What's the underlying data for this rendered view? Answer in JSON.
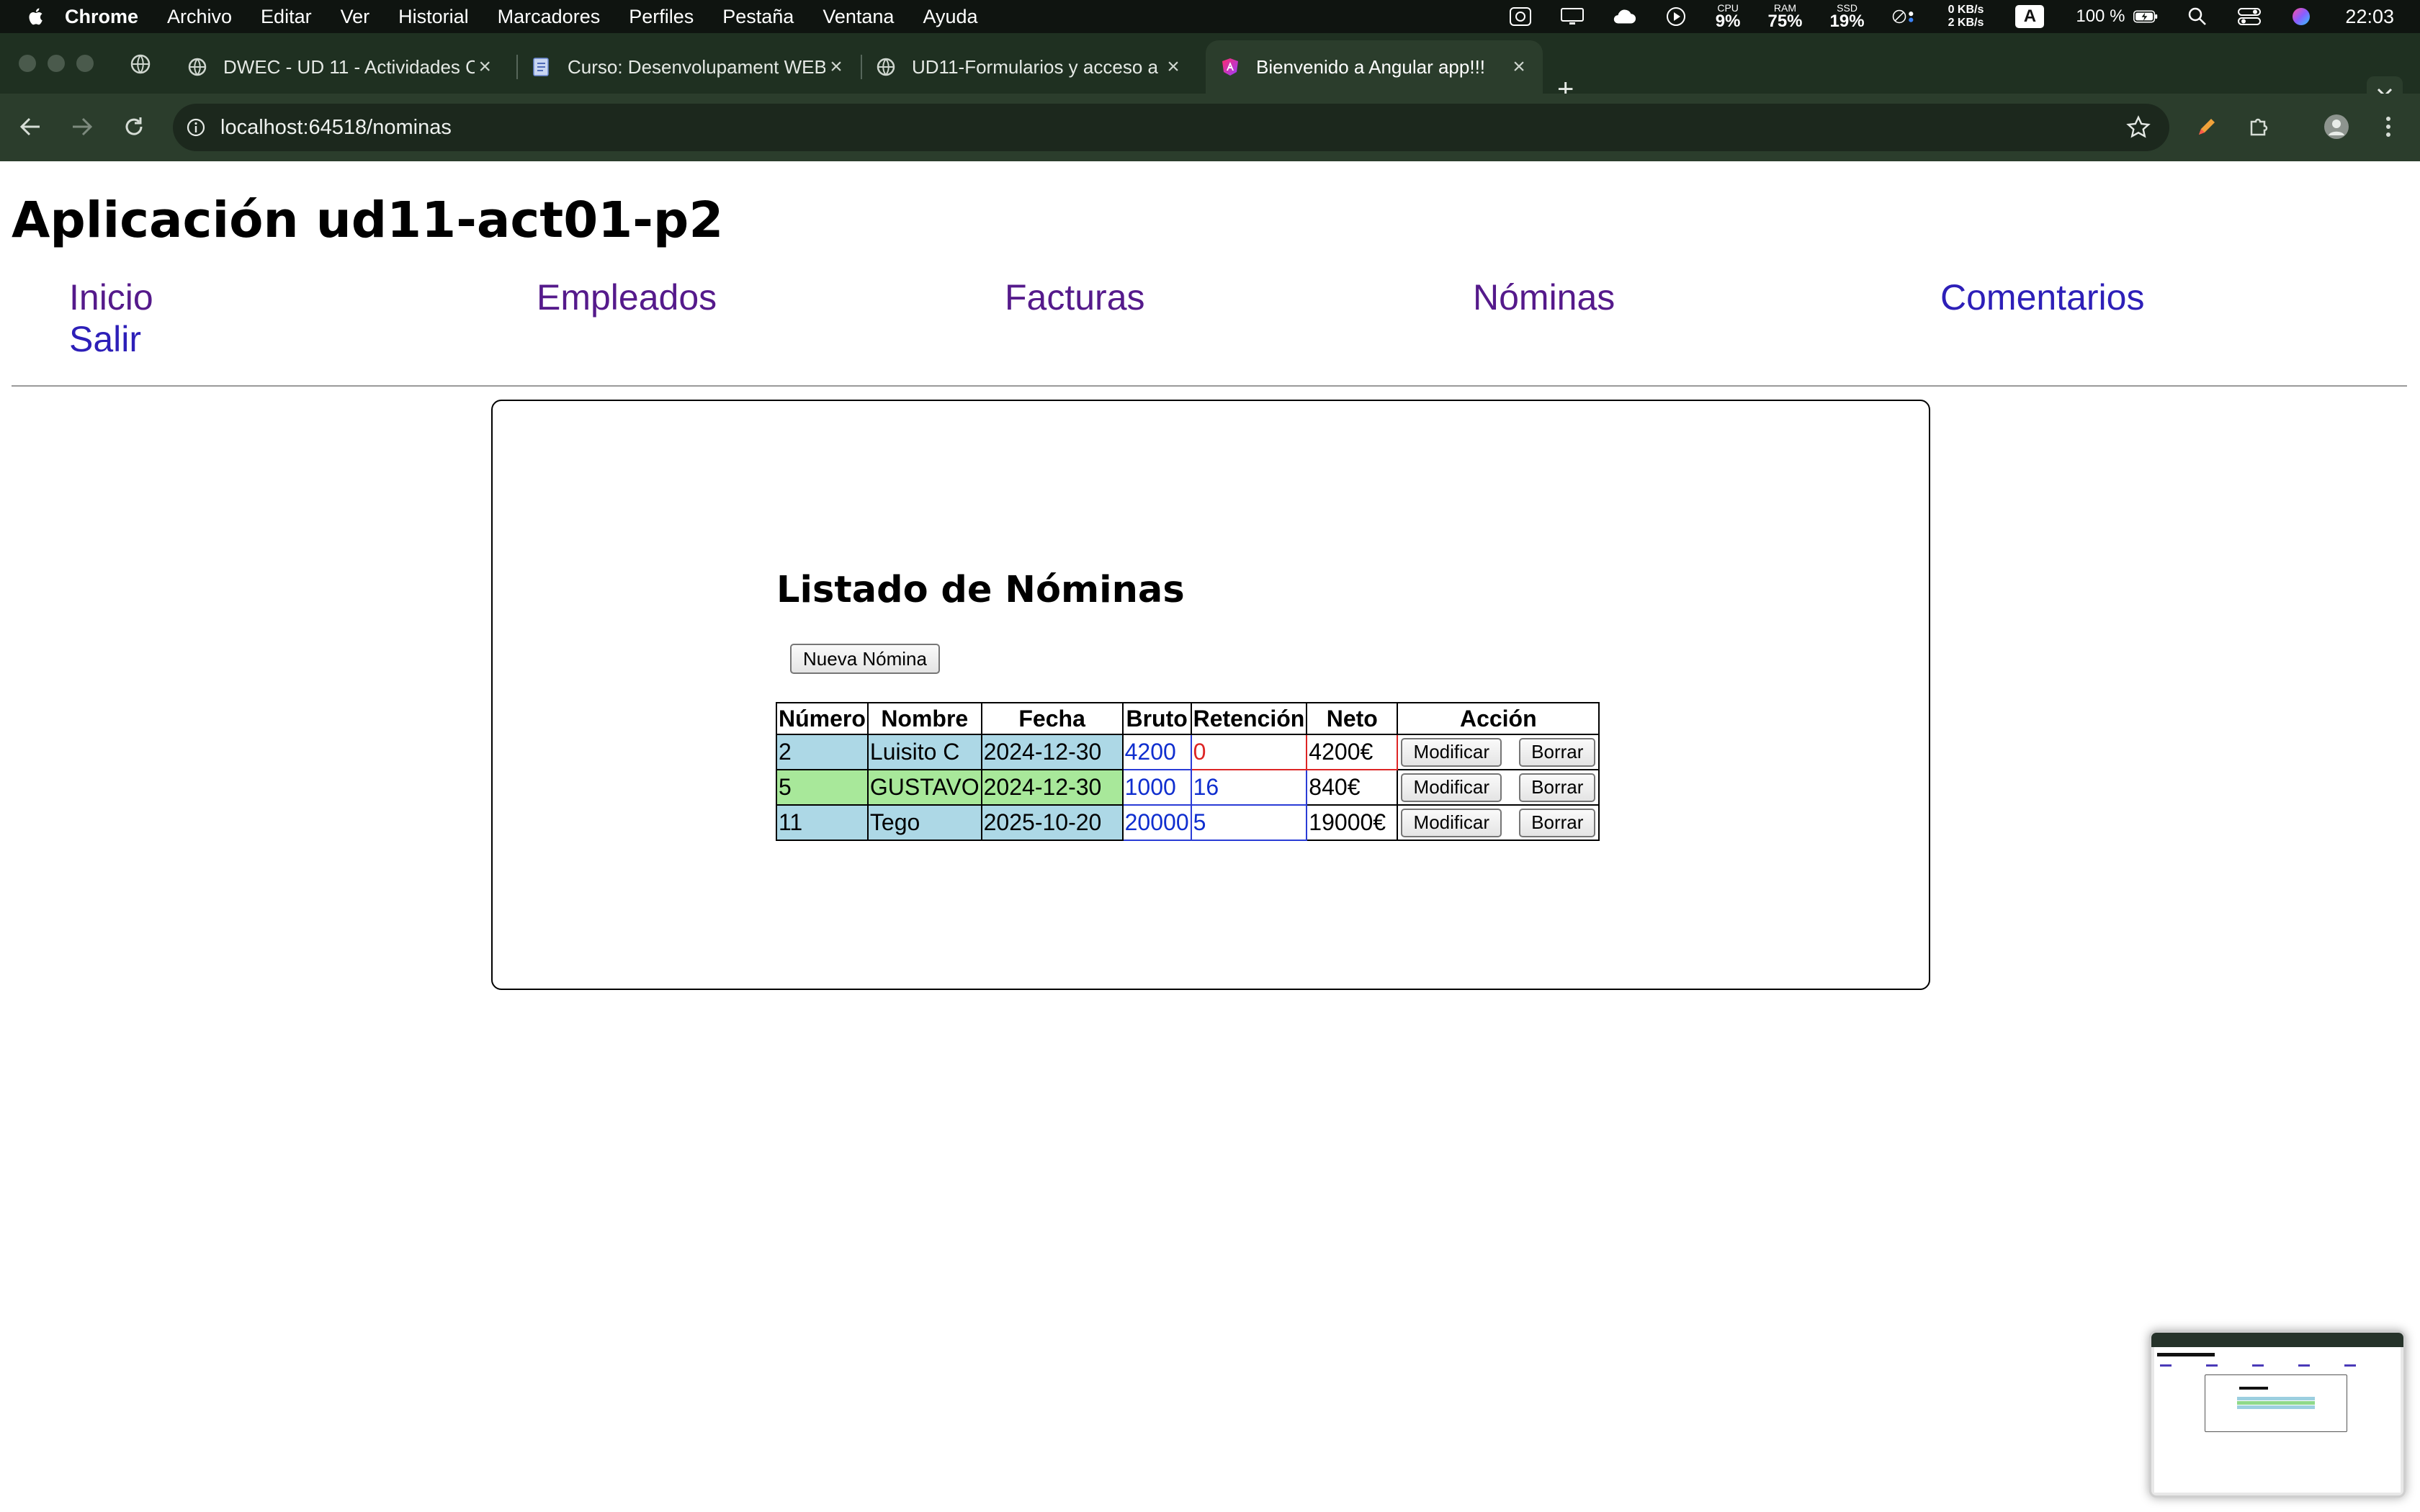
{
  "menubar": {
    "app": "Chrome",
    "items": [
      "Archivo",
      "Editar",
      "Ver",
      "Historial",
      "Marcadores",
      "Perfiles",
      "Pestaña",
      "Ventana",
      "Ayuda"
    ],
    "cpu_label": "CPU",
    "cpu_value": "9%",
    "ram_label": "RAM",
    "ram_value": "75%",
    "ssd_label": "SSD",
    "ssd_value": "19%",
    "net_down": "0 KB/s",
    "net_up": "2 KB/s",
    "input_source": "A",
    "battery": "100 %",
    "clock": "22:03"
  },
  "tabs": [
    {
      "title": "DWEC - UD 11 - Actividades C",
      "icon": "globe-icon",
      "active": false
    },
    {
      "title": "Curso: Desenvolupament WEB",
      "icon": "document-icon",
      "active": false
    },
    {
      "title": "UD11-Formularios y acceso a",
      "icon": "globe-icon",
      "active": false
    },
    {
      "title": "Bienvenido a Angular app!!!",
      "icon": "angular-icon",
      "active": true
    }
  ],
  "new_tab_label": "+",
  "address_bar": {
    "url": "localhost:64518/nominas"
  },
  "page": {
    "title": "Aplicación ud11-act01-p2",
    "nav": [
      {
        "label": "Inicio",
        "visited": true
      },
      {
        "label": "Empleados",
        "visited": true
      },
      {
        "label": "Facturas",
        "visited": true
      },
      {
        "label": "Nóminas",
        "visited": true
      },
      {
        "label": "Comentarios",
        "visited": false
      },
      {
        "label": "Salir",
        "visited": false
      }
    ],
    "list_title": "Listado de Nóminas",
    "new_button": "Nueva Nómina",
    "table": {
      "headers": [
        "Número",
        "Nombre",
        "Fecha",
        "Bruto",
        "Retención",
        "Neto",
        "Acción"
      ],
      "rows": [
        {
          "numero": "2",
          "nombre": "Luisito C",
          "fecha": "2024-12-30",
          "bruto": "4200",
          "retencion": "0",
          "neto": "4200€",
          "row_color": "#add8e6"
        },
        {
          "numero": "5",
          "nombre": "GUSTAVO",
          "fecha": "2024-12-30",
          "bruto": "1000",
          "retencion": "16",
          "neto": "840€",
          "row_color": "#a8e89a"
        },
        {
          "numero": "11",
          "nombre": "Tego",
          "fecha": "2025-10-20",
          "bruto": "20000",
          "retencion": "5",
          "neto": "19000€",
          "row_color": "#add8e6"
        }
      ],
      "modify_label": "Modificar",
      "delete_label": "Borrar"
    }
  },
  "colors": {
    "link": "#2d1fb8",
    "visited_link": "#551a8b",
    "value_blue": "#0f2ecf",
    "value_red": "#dd2525"
  }
}
